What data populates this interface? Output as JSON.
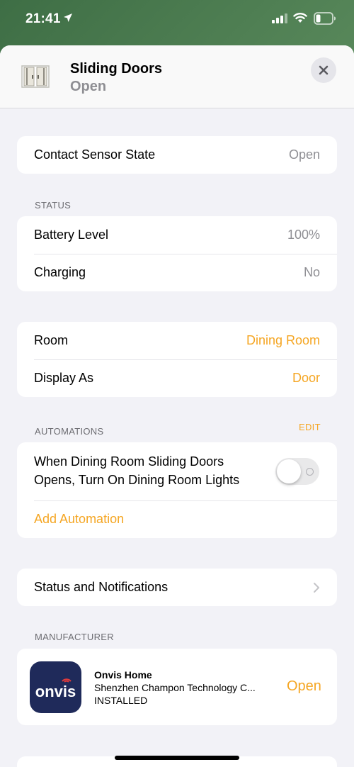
{
  "status_bar": {
    "time": "21:41"
  },
  "header": {
    "title": "Sliding Doors",
    "subtitle": "Open",
    "icon": "sliding-door-icon"
  },
  "sensor": {
    "label": "Contact Sensor State",
    "value": "Open"
  },
  "status_section": {
    "heading": "STATUS",
    "rows": [
      {
        "label": "Battery Level",
        "value": "100%"
      },
      {
        "label": "Charging",
        "value": "No"
      }
    ]
  },
  "room_section": {
    "rows": [
      {
        "label": "Room",
        "value": "Dining Room"
      },
      {
        "label": "Display As",
        "value": "Door"
      }
    ]
  },
  "automations": {
    "heading": "AUTOMATIONS",
    "edit_label": "EDIT",
    "item_text": "When Dining Room Sliding Doors Opens, Turn On Dining Room Lights",
    "toggle_on": false,
    "add_label": "Add Automation"
  },
  "notifications": {
    "label": "Status and Notifications"
  },
  "manufacturer": {
    "heading": "MANUFACTURER",
    "app_icon_text": "onvis",
    "app_name": "Onvis Home",
    "developer": "Shenzhen Champon Technology C...",
    "state": "INSTALLED",
    "open_label": "Open"
  },
  "colors": {
    "accent": "#f5a623",
    "secondary_text": "#8e8e93"
  }
}
